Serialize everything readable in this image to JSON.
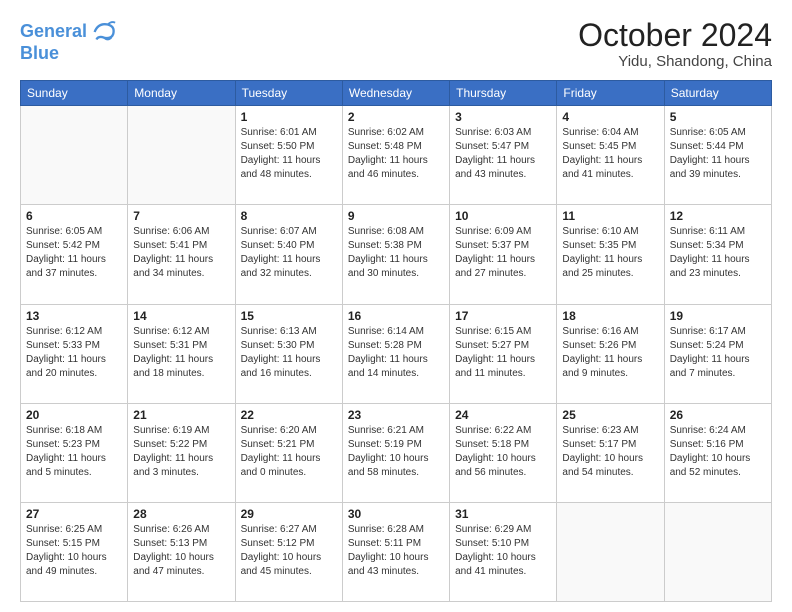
{
  "header": {
    "logo_line1": "General",
    "logo_line2": "Blue",
    "month": "October 2024",
    "location": "Yidu, Shandong, China"
  },
  "weekdays": [
    "Sunday",
    "Monday",
    "Tuesday",
    "Wednesday",
    "Thursday",
    "Friday",
    "Saturday"
  ],
  "weeks": [
    [
      {
        "day": "",
        "info": ""
      },
      {
        "day": "",
        "info": ""
      },
      {
        "day": "1",
        "info": "Sunrise: 6:01 AM\nSunset: 5:50 PM\nDaylight: 11 hours and 48 minutes."
      },
      {
        "day": "2",
        "info": "Sunrise: 6:02 AM\nSunset: 5:48 PM\nDaylight: 11 hours and 46 minutes."
      },
      {
        "day": "3",
        "info": "Sunrise: 6:03 AM\nSunset: 5:47 PM\nDaylight: 11 hours and 43 minutes."
      },
      {
        "day": "4",
        "info": "Sunrise: 6:04 AM\nSunset: 5:45 PM\nDaylight: 11 hours and 41 minutes."
      },
      {
        "day": "5",
        "info": "Sunrise: 6:05 AM\nSunset: 5:44 PM\nDaylight: 11 hours and 39 minutes."
      }
    ],
    [
      {
        "day": "6",
        "info": "Sunrise: 6:05 AM\nSunset: 5:42 PM\nDaylight: 11 hours and 37 minutes."
      },
      {
        "day": "7",
        "info": "Sunrise: 6:06 AM\nSunset: 5:41 PM\nDaylight: 11 hours and 34 minutes."
      },
      {
        "day": "8",
        "info": "Sunrise: 6:07 AM\nSunset: 5:40 PM\nDaylight: 11 hours and 32 minutes."
      },
      {
        "day": "9",
        "info": "Sunrise: 6:08 AM\nSunset: 5:38 PM\nDaylight: 11 hours and 30 minutes."
      },
      {
        "day": "10",
        "info": "Sunrise: 6:09 AM\nSunset: 5:37 PM\nDaylight: 11 hours and 27 minutes."
      },
      {
        "day": "11",
        "info": "Sunrise: 6:10 AM\nSunset: 5:35 PM\nDaylight: 11 hours and 25 minutes."
      },
      {
        "day": "12",
        "info": "Sunrise: 6:11 AM\nSunset: 5:34 PM\nDaylight: 11 hours and 23 minutes."
      }
    ],
    [
      {
        "day": "13",
        "info": "Sunrise: 6:12 AM\nSunset: 5:33 PM\nDaylight: 11 hours and 20 minutes."
      },
      {
        "day": "14",
        "info": "Sunrise: 6:12 AM\nSunset: 5:31 PM\nDaylight: 11 hours and 18 minutes."
      },
      {
        "day": "15",
        "info": "Sunrise: 6:13 AM\nSunset: 5:30 PM\nDaylight: 11 hours and 16 minutes."
      },
      {
        "day": "16",
        "info": "Sunrise: 6:14 AM\nSunset: 5:28 PM\nDaylight: 11 hours and 14 minutes."
      },
      {
        "day": "17",
        "info": "Sunrise: 6:15 AM\nSunset: 5:27 PM\nDaylight: 11 hours and 11 minutes."
      },
      {
        "day": "18",
        "info": "Sunrise: 6:16 AM\nSunset: 5:26 PM\nDaylight: 11 hours and 9 minutes."
      },
      {
        "day": "19",
        "info": "Sunrise: 6:17 AM\nSunset: 5:24 PM\nDaylight: 11 hours and 7 minutes."
      }
    ],
    [
      {
        "day": "20",
        "info": "Sunrise: 6:18 AM\nSunset: 5:23 PM\nDaylight: 11 hours and 5 minutes."
      },
      {
        "day": "21",
        "info": "Sunrise: 6:19 AM\nSunset: 5:22 PM\nDaylight: 11 hours and 3 minutes."
      },
      {
        "day": "22",
        "info": "Sunrise: 6:20 AM\nSunset: 5:21 PM\nDaylight: 11 hours and 0 minutes."
      },
      {
        "day": "23",
        "info": "Sunrise: 6:21 AM\nSunset: 5:19 PM\nDaylight: 10 hours and 58 minutes."
      },
      {
        "day": "24",
        "info": "Sunrise: 6:22 AM\nSunset: 5:18 PM\nDaylight: 10 hours and 56 minutes."
      },
      {
        "day": "25",
        "info": "Sunrise: 6:23 AM\nSunset: 5:17 PM\nDaylight: 10 hours and 54 minutes."
      },
      {
        "day": "26",
        "info": "Sunrise: 6:24 AM\nSunset: 5:16 PM\nDaylight: 10 hours and 52 minutes."
      }
    ],
    [
      {
        "day": "27",
        "info": "Sunrise: 6:25 AM\nSunset: 5:15 PM\nDaylight: 10 hours and 49 minutes."
      },
      {
        "day": "28",
        "info": "Sunrise: 6:26 AM\nSunset: 5:13 PM\nDaylight: 10 hours and 47 minutes."
      },
      {
        "day": "29",
        "info": "Sunrise: 6:27 AM\nSunset: 5:12 PM\nDaylight: 10 hours and 45 minutes."
      },
      {
        "day": "30",
        "info": "Sunrise: 6:28 AM\nSunset: 5:11 PM\nDaylight: 10 hours and 43 minutes."
      },
      {
        "day": "31",
        "info": "Sunrise: 6:29 AM\nSunset: 5:10 PM\nDaylight: 10 hours and 41 minutes."
      },
      {
        "day": "",
        "info": ""
      },
      {
        "day": "",
        "info": ""
      }
    ]
  ]
}
